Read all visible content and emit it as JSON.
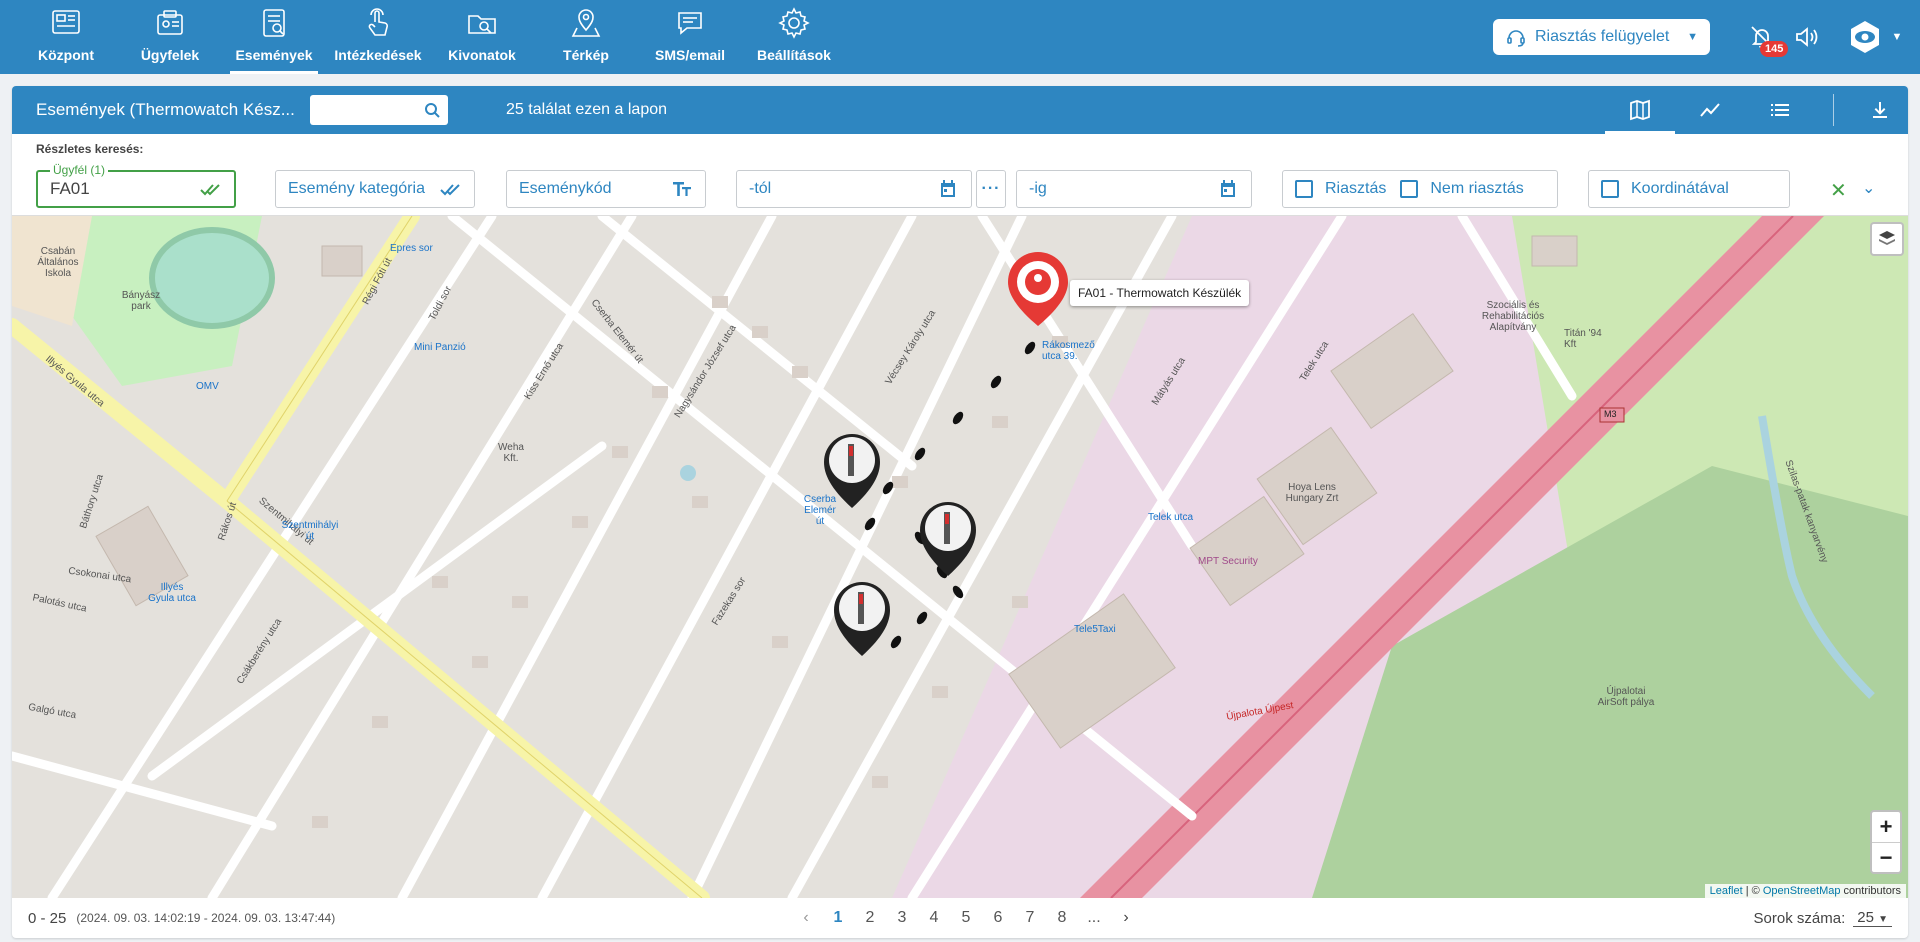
{
  "nav": {
    "items": [
      {
        "label": "Központ",
        "icon": "dashboard-icon"
      },
      {
        "label": "Ügyfelek",
        "icon": "client-card-icon"
      },
      {
        "label": "Események",
        "icon": "event-list-icon"
      },
      {
        "label": "Intézkedések",
        "icon": "hand-touch-icon"
      },
      {
        "label": "Kivonatok",
        "icon": "folder-search-icon"
      },
      {
        "label": "Térkép",
        "icon": "map-pin-icon"
      },
      {
        "label": "SMS/email",
        "icon": "chat-icon"
      },
      {
        "label": "Beállítások",
        "icon": "gear-icon"
      }
    ],
    "active": "Események",
    "alarm_select": "Riasztás felügyelet",
    "badge_count": "145"
  },
  "toolbar": {
    "title": "Események (Thermowatch Kész...",
    "search_placeholder": "",
    "result_count": "25 találat ezen a lapon"
  },
  "filters": {
    "label": "Részletes keresés:",
    "client_floating": "Ügyfél (1)",
    "client_value": "FA01",
    "category": "Esemény kategória",
    "code": "Eseménykód",
    "from": "-tól",
    "to": "-ig",
    "alarm": "Riasztás",
    "no_alarm": "Nem riasztás",
    "coords": "Koordinátával"
  },
  "map": {
    "tooltip": "FA01 - Thermowatch Készülék",
    "attribution_leaflet": "Leaflet",
    "attribution_sep": " | © ",
    "attribution_osm": "OpenStreetMap",
    "attribution_tail": " contributors",
    "labels": [
      {
        "t": "Csabán Általános Iskola",
        "c": ""
      },
      {
        "t": "Bányász park",
        "c": ""
      },
      {
        "t": "Régi Fóti út",
        "c": ""
      },
      {
        "t": "Toldi sor",
        "c": ""
      },
      {
        "t": "Illyés Gyula utca",
        "c": ""
      },
      {
        "t": "Epres sor",
        "c": "blue"
      },
      {
        "t": "Mini Panzió",
        "c": "blue"
      },
      {
        "t": "OMV",
        "c": "blue"
      },
      {
        "t": "Báthory utca",
        "c": ""
      },
      {
        "t": "Szentmihályi út",
        "c": ""
      },
      {
        "t": "Rákos út",
        "c": ""
      },
      {
        "t": "Csokonai utca",
        "c": ""
      },
      {
        "t": "Palotás utca",
        "c": ""
      },
      {
        "t": "Galgó utca",
        "c": ""
      },
      {
        "t": "Csákberény utca",
        "c": ""
      },
      {
        "t": "Kiss Ernő utca",
        "c": ""
      },
      {
        "t": "Weha Kft.",
        "c": ""
      },
      {
        "t": "Nagysándor József utca",
        "c": ""
      },
      {
        "t": "Cserba Elemér út",
        "c": ""
      },
      {
        "t": "Vécsey Károly utca",
        "c": ""
      },
      {
        "t": "Rákosmező utca 39.",
        "c": "blue"
      },
      {
        "t": "Mátyás utca",
        "c": ""
      },
      {
        "t": "Telek utca",
        "c": ""
      },
      {
        "t": "Telek utca",
        "c": "blue"
      },
      {
        "t": "Hoya Lens Hungary Zrt",
        "c": ""
      },
      {
        "t": "MPT Security",
        "c": ""
      },
      {
        "t": "Tele5Taxi",
        "c": "blue"
      },
      {
        "t": "M3",
        "c": ""
      },
      {
        "t": "Szociális és Rehabilitációs Alapítvány",
        "c": ""
      },
      {
        "t": "Titán '94 Kft",
        "c": ""
      },
      {
        "t": "Újpalota Újpest",
        "c": "red"
      },
      {
        "t": "Újpalotai AirSoft pálya",
        "c": ""
      },
      {
        "t": "Szilas-patak kanyarvény",
        "c": ""
      },
      {
        "t": "Fazekas sor",
        "c": ""
      },
      {
        "t": "Szentmihályi út",
        "c": "blue"
      },
      {
        "t": "Illyés Gyula utca",
        "c": "blue"
      },
      {
        "t": "Cserba Elemér út",
        "c": "blue"
      }
    ]
  },
  "footer": {
    "range": "0 - 25",
    "dates": "(2024. 09. 03. 14:02:19 - 2024. 09. 03. 13:47:44)",
    "pages": [
      "1",
      "2",
      "3",
      "4",
      "5",
      "6",
      "7",
      "8",
      "..."
    ],
    "active_page": "1",
    "rows_label": "Sorok száma:",
    "rows_value": "25"
  }
}
